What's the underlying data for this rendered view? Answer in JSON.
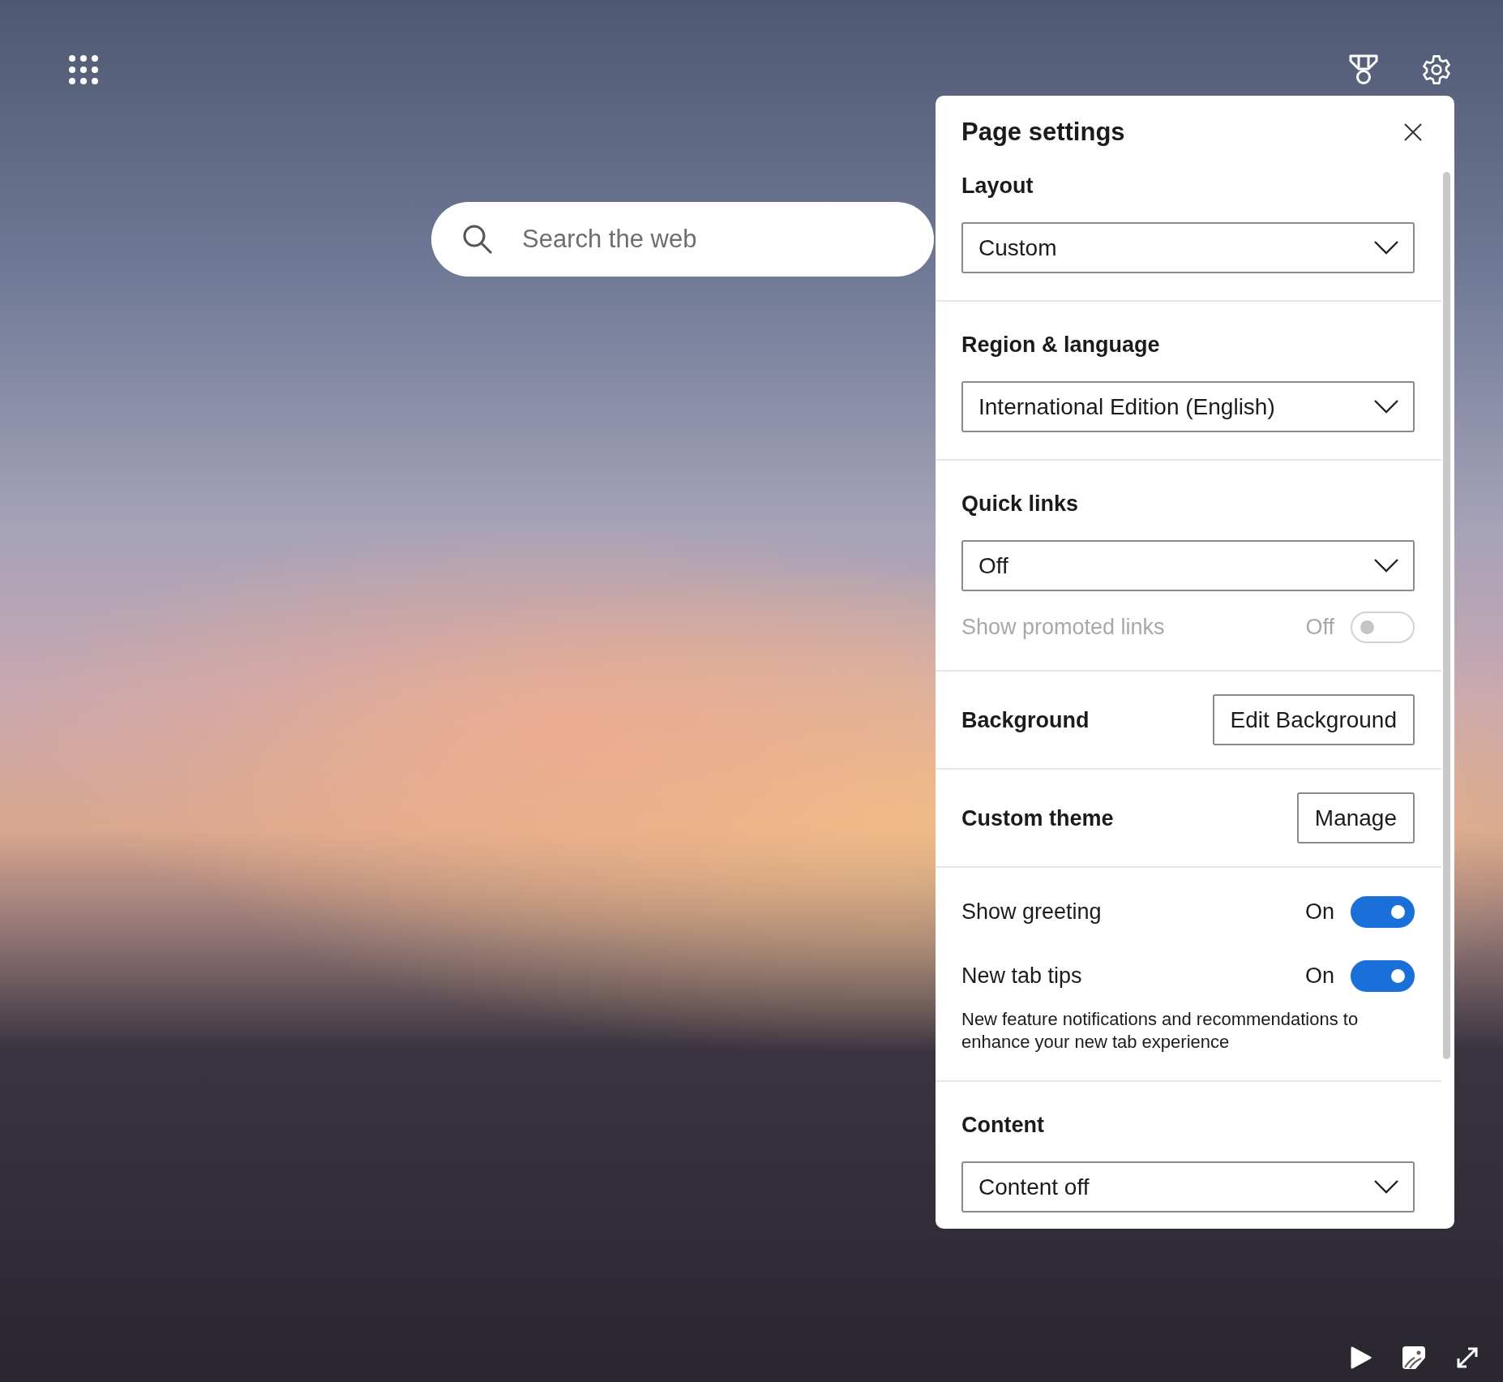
{
  "search": {
    "placeholder": "Search the web"
  },
  "panel": {
    "title": "Page settings",
    "sections": [
      {
        "kind": "dropdown",
        "heading": "Layout",
        "value": "Custom"
      },
      {
        "kind": "dropdown",
        "heading": "Region & language",
        "value": "International Edition (English)"
      },
      {
        "kind": "dropdown",
        "heading": "Quick links",
        "value": "Off",
        "toggles": [
          {
            "label": "Show promoted links",
            "state": "Off",
            "on": false,
            "disabled": true
          }
        ]
      },
      {
        "kind": "button",
        "heading": "Background",
        "button": "Edit Background"
      },
      {
        "kind": "button",
        "heading": "Custom theme",
        "button": "Manage"
      },
      {
        "kind": "toggles",
        "toggles": [
          {
            "label": "Show greeting",
            "state": "On",
            "on": true,
            "disabled": false
          },
          {
            "label": "New tab tips",
            "state": "On",
            "on": true,
            "disabled": false,
            "description": "New feature notifications and recommendations to enhance your new tab experience"
          }
        ]
      },
      {
        "kind": "dropdown",
        "heading": "Content",
        "value": "Content off"
      }
    ]
  }
}
